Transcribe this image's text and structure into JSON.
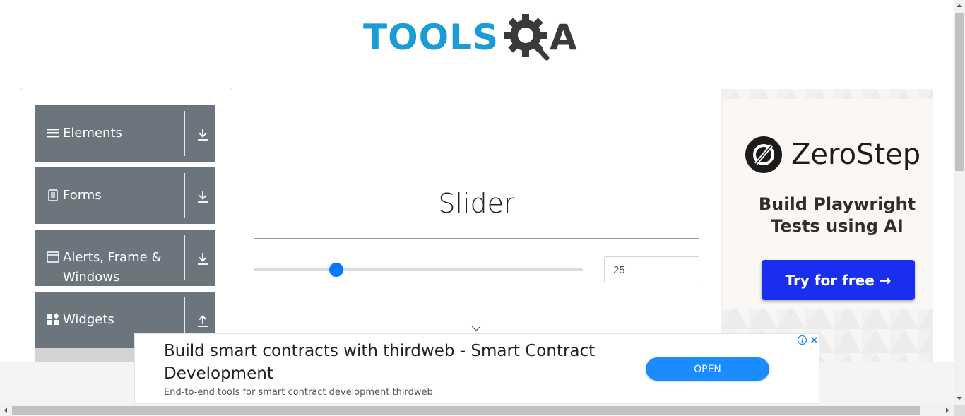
{
  "header": {
    "logo_text": "TOOLS",
    "logo_text_tail": "A",
    "brand_color": "#1b9bd8"
  },
  "sidebar": {
    "groups": [
      {
        "label": "Elements",
        "icon": "hamburger-icon",
        "arrow": "download-arrow-icon"
      },
      {
        "label": "Forms",
        "icon": "document-icon",
        "arrow": "download-arrow-icon"
      },
      {
        "label": "Alerts, Frame & Windows",
        "icon": "window-icon",
        "arrow": "download-arrow-icon"
      },
      {
        "label": "Widgets",
        "icon": "widgets-icon",
        "arrow": "upload-arrow-icon"
      }
    ],
    "group_color": "#6c757d"
  },
  "main": {
    "title": "Slider",
    "slider": {
      "value": 25,
      "min": 0,
      "max": 100,
      "display": "25"
    },
    "accent": "#007bff"
  },
  "right_ad": {
    "brand": "ZeroStep",
    "tagline": "Build Playwright Tests using AI",
    "cta": "Try for free →",
    "cta_color": "#1a2ef0"
  },
  "bottom_ad": {
    "title": "Build smart contracts with thirdweb - Smart Contract Development",
    "description": "End-to-end tools for smart contract development thirdweb",
    "button": "OPEN",
    "button_color": "#1a8cff"
  }
}
